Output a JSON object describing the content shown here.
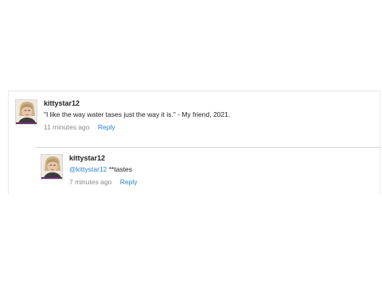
{
  "comments": [
    {
      "username": "kittystar12",
      "text": "\"I like the way water tases just the way it is.\" - My friend, 2021.",
      "timestamp": "11 minutes ago",
      "reply_label": "Reply"
    },
    {
      "username": "kittystar12",
      "mention": "@kittystar12",
      "text": " **tastes",
      "timestamp": "7 minutes ago",
      "reply_label": "Reply"
    }
  ],
  "colors": {
    "link": "#2a86c7",
    "meta": "#8a8a8a",
    "text": "#222222"
  },
  "icons": {
    "avatar": "user-avatar-photo"
  }
}
